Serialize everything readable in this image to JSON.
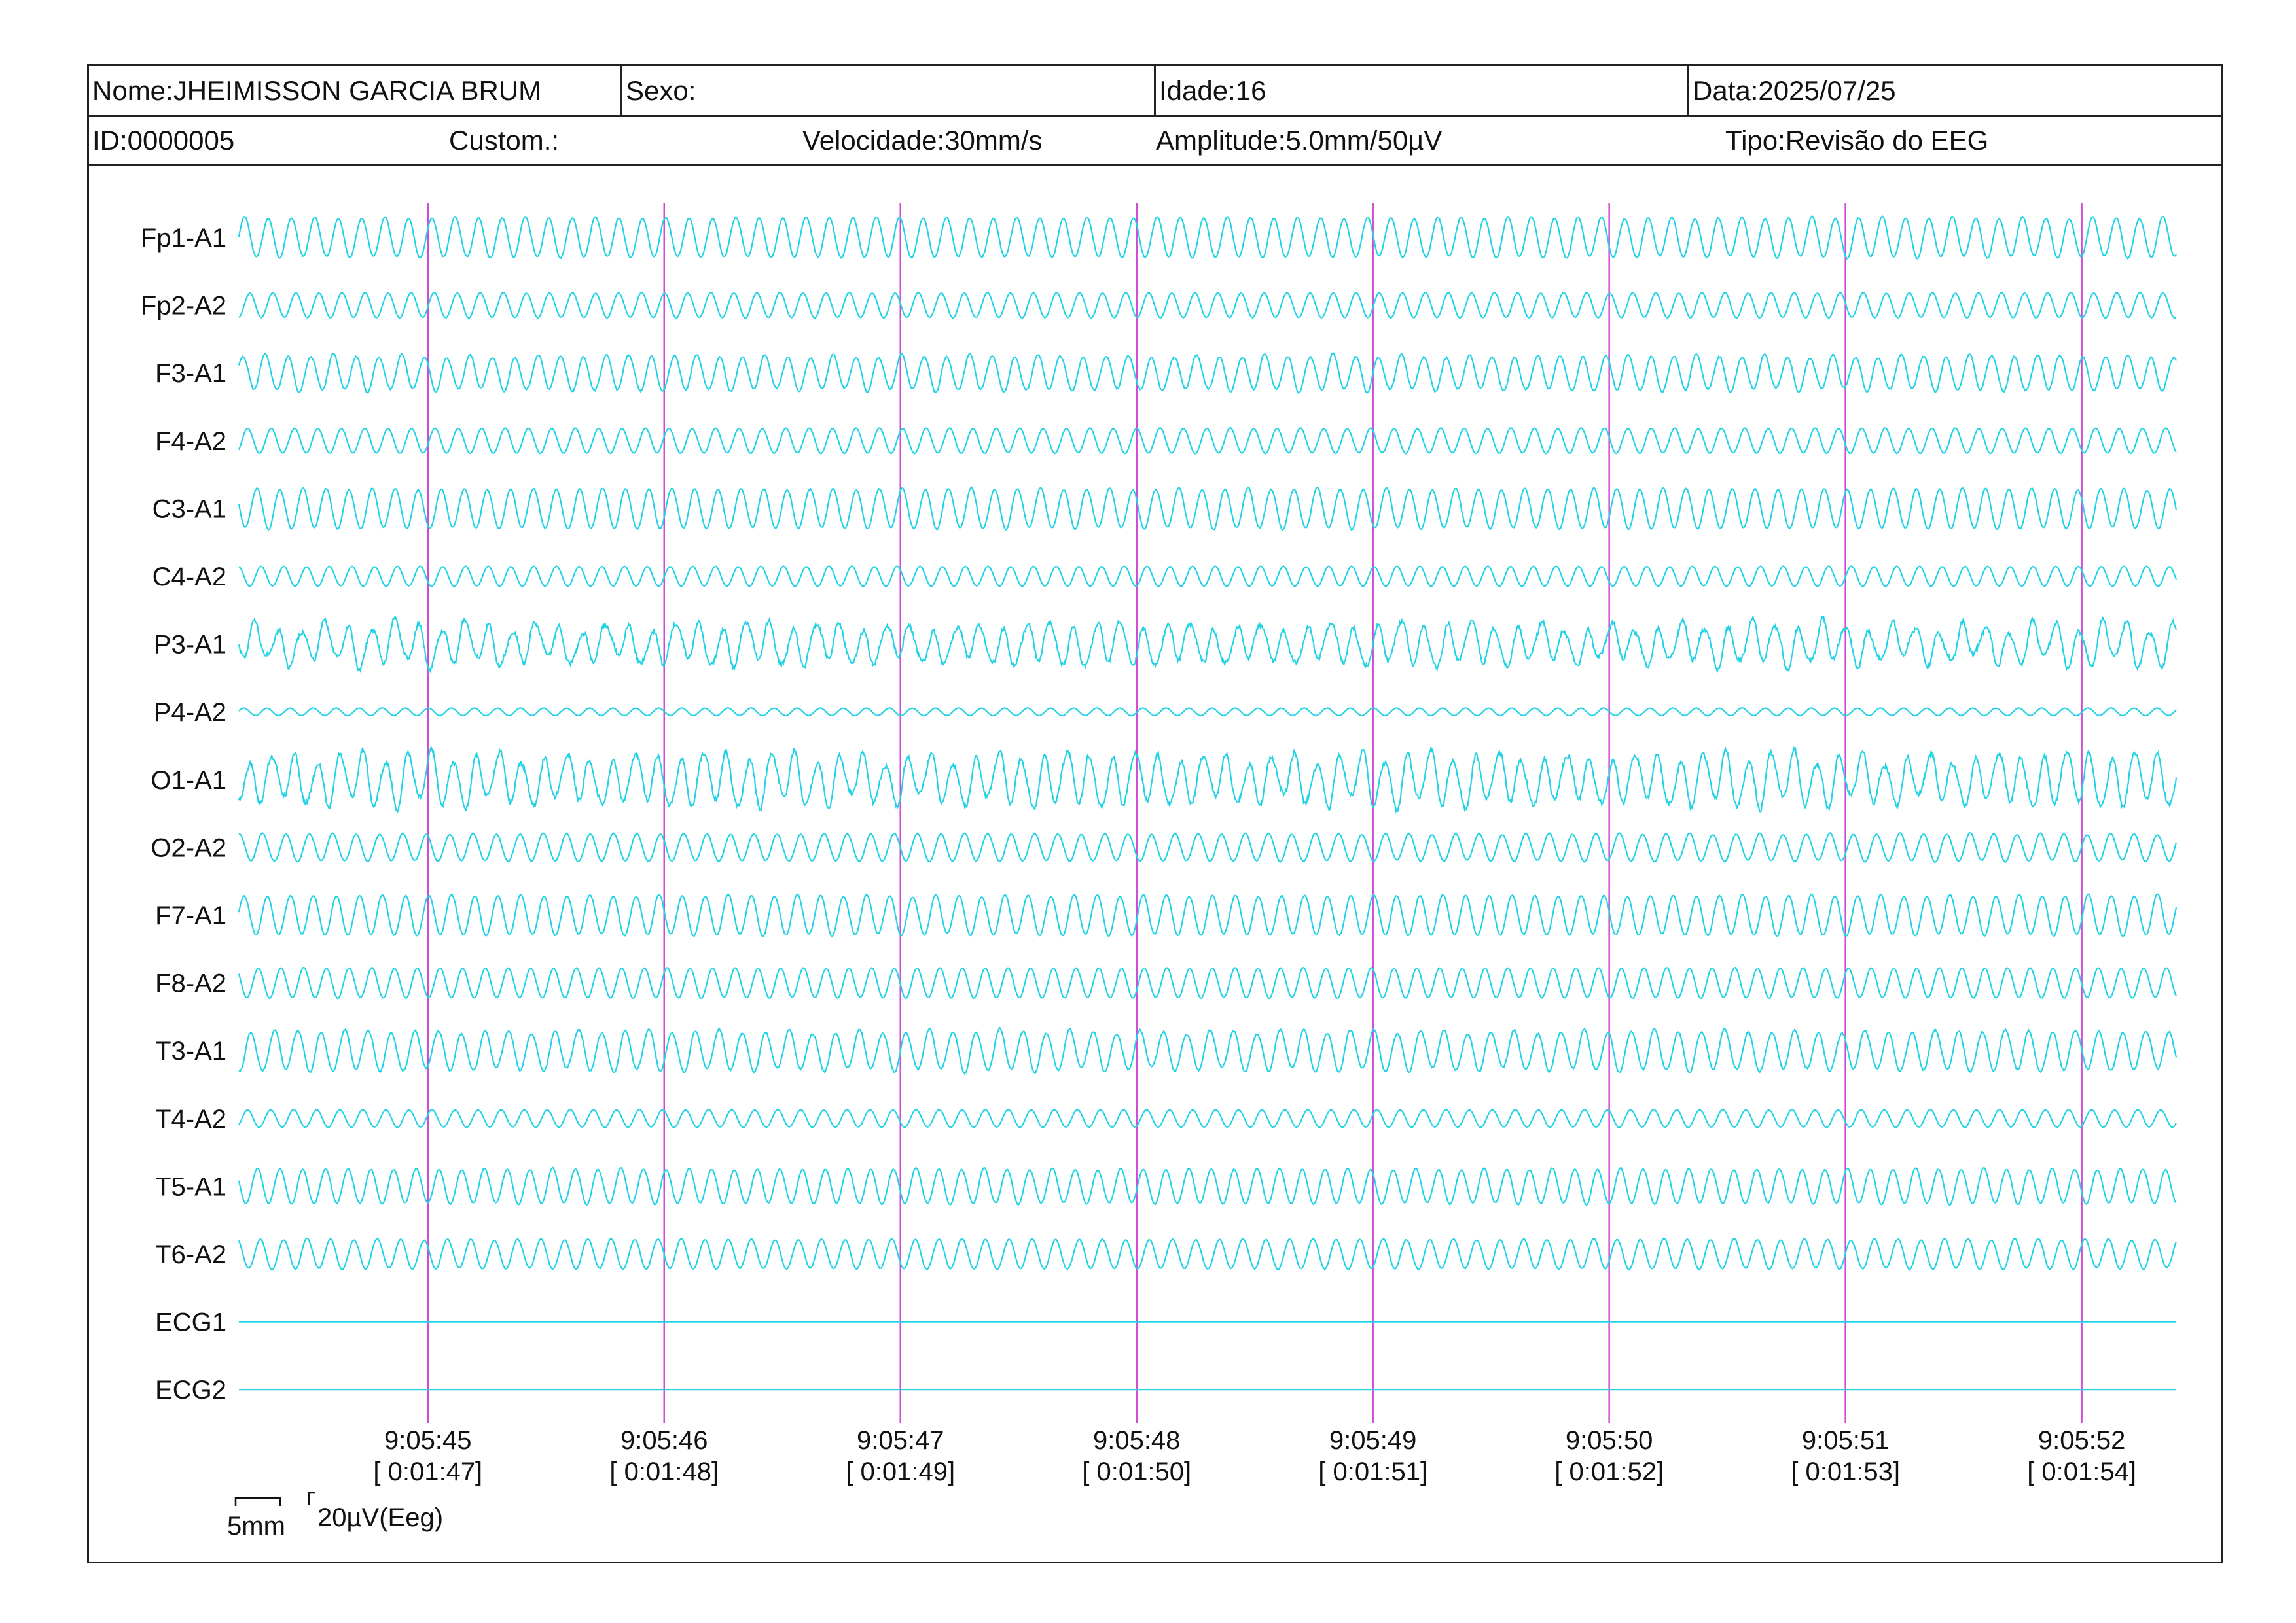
{
  "header": {
    "nome": "Nome:JHEIMISSON GARCIA BRUM",
    "sexo": "Sexo:",
    "idade": "Idade:16",
    "data": "Data:2025/07/25",
    "id": "ID:0000005",
    "custom": "Custom.:",
    "velocidade": "Velocidade:30mm/s",
    "amplitude": "Amplitude:5.0mm/50µV",
    "tipo": "Tipo:Revisão do EEG"
  },
  "colors": {
    "trace": "#22d3e6",
    "marker": "#d24bd6",
    "border": "#222222"
  },
  "chart_data": {
    "type": "line",
    "channels": [
      {
        "name": "Fp1-A1",
        "amplitude": 0.8,
        "irregularity": 0.1
      },
      {
        "name": "Fp2-A2",
        "amplitude": 0.5,
        "irregularity": 0.05
      },
      {
        "name": "F3-A1",
        "amplitude": 0.7,
        "irregularity": 0.2
      },
      {
        "name": "F4-A2",
        "amplitude": 0.5,
        "irregularity": 0.05
      },
      {
        "name": "C3-A1",
        "amplitude": 0.8,
        "irregularity": 0.1
      },
      {
        "name": "C4-A2",
        "amplitude": 0.4,
        "irregularity": 0.05
      },
      {
        "name": "P3-A1",
        "amplitude": 0.8,
        "irregularity": 0.6
      },
      {
        "name": "P4-A2",
        "amplitude": 0.15,
        "irregularity": 0.05
      },
      {
        "name": "O1-A1",
        "amplitude": 1.0,
        "irregularity": 0.5
      },
      {
        "name": "O2-A2",
        "amplitude": 0.55,
        "irregularity": 0.1
      },
      {
        "name": "F7-A1",
        "amplitude": 0.8,
        "irregularity": 0.1
      },
      {
        "name": "F8-A2",
        "amplitude": 0.6,
        "irregularity": 0.05
      },
      {
        "name": "T3-A1",
        "amplitude": 0.8,
        "irregularity": 0.2
      },
      {
        "name": "T4-A2",
        "amplitude": 0.35,
        "irregularity": 0.05
      },
      {
        "name": "T5-A1",
        "amplitude": 0.7,
        "irregularity": 0.1
      },
      {
        "name": "T6-A2",
        "amplitude": 0.6,
        "irregularity": 0.1
      },
      {
        "name": "ECG1",
        "amplitude": 0,
        "irregularity": 0
      },
      {
        "name": "ECG2",
        "amplitude": 0,
        "irregularity": 0
      }
    ],
    "time_start": "9:05:44.2",
    "time_end": "9:05:52.4",
    "time_markers": [
      {
        "time": "9:05:45",
        "elapsed": "[ 0:01:47]"
      },
      {
        "time": "9:05:46",
        "elapsed": "[ 0:01:48]"
      },
      {
        "time": "9:05:47",
        "elapsed": "[ 0:01:49]"
      },
      {
        "time": "9:05:48",
        "elapsed": "[ 0:01:50]"
      },
      {
        "time": "9:05:49",
        "elapsed": "[ 0:01:51]"
      },
      {
        "time": "9:05:50",
        "elapsed": "[ 0:01:52]"
      },
      {
        "time": "9:05:51",
        "elapsed": "[ 0:01:53]"
      },
      {
        "time": "9:05:52",
        "elapsed": "[ 0:01:54]"
      }
    ],
    "scale": {
      "time_label": "5mm",
      "amplitude_label": "20µV(Eeg)"
    }
  }
}
